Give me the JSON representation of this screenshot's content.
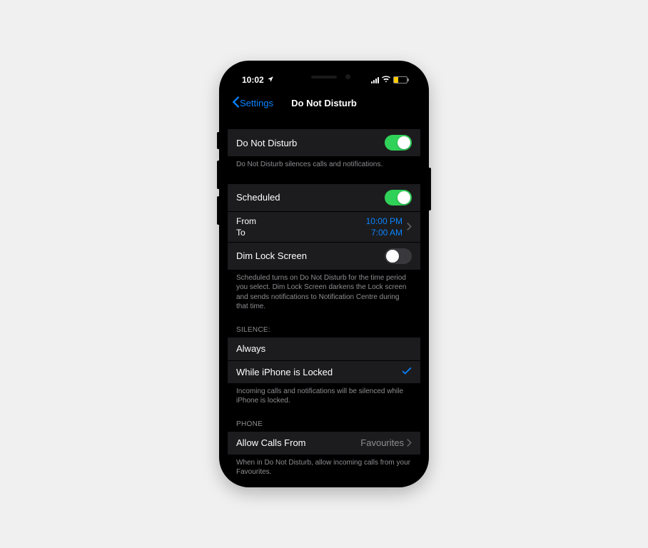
{
  "status": {
    "time": "10:02"
  },
  "nav": {
    "back": "Settings",
    "title": "Do Not Disturb"
  },
  "dnd": {
    "label": "Do Not Disturb",
    "footer": "Do Not Disturb silences calls and notifications."
  },
  "scheduled": {
    "label": "Scheduled",
    "from_label": "From",
    "to_label": "To",
    "from_value": "10:00 PM",
    "to_value": "7:00 AM",
    "dim_label": "Dim Lock Screen",
    "footer": "Scheduled turns on Do Not Disturb for the time period you select. Dim Lock Screen darkens the Lock screen and sends notifications to Notification Centre during that time."
  },
  "silence": {
    "header": "SILENCE:",
    "always": "Always",
    "while_locked": "While iPhone is Locked",
    "footer": "Incoming calls and notifications will be silenced while iPhone is locked."
  },
  "phone": {
    "header": "PHONE",
    "allow_label": "Allow Calls From",
    "allow_value": "Favourites",
    "footer": "When in Do Not Disturb, allow incoming calls from your Favourites."
  }
}
